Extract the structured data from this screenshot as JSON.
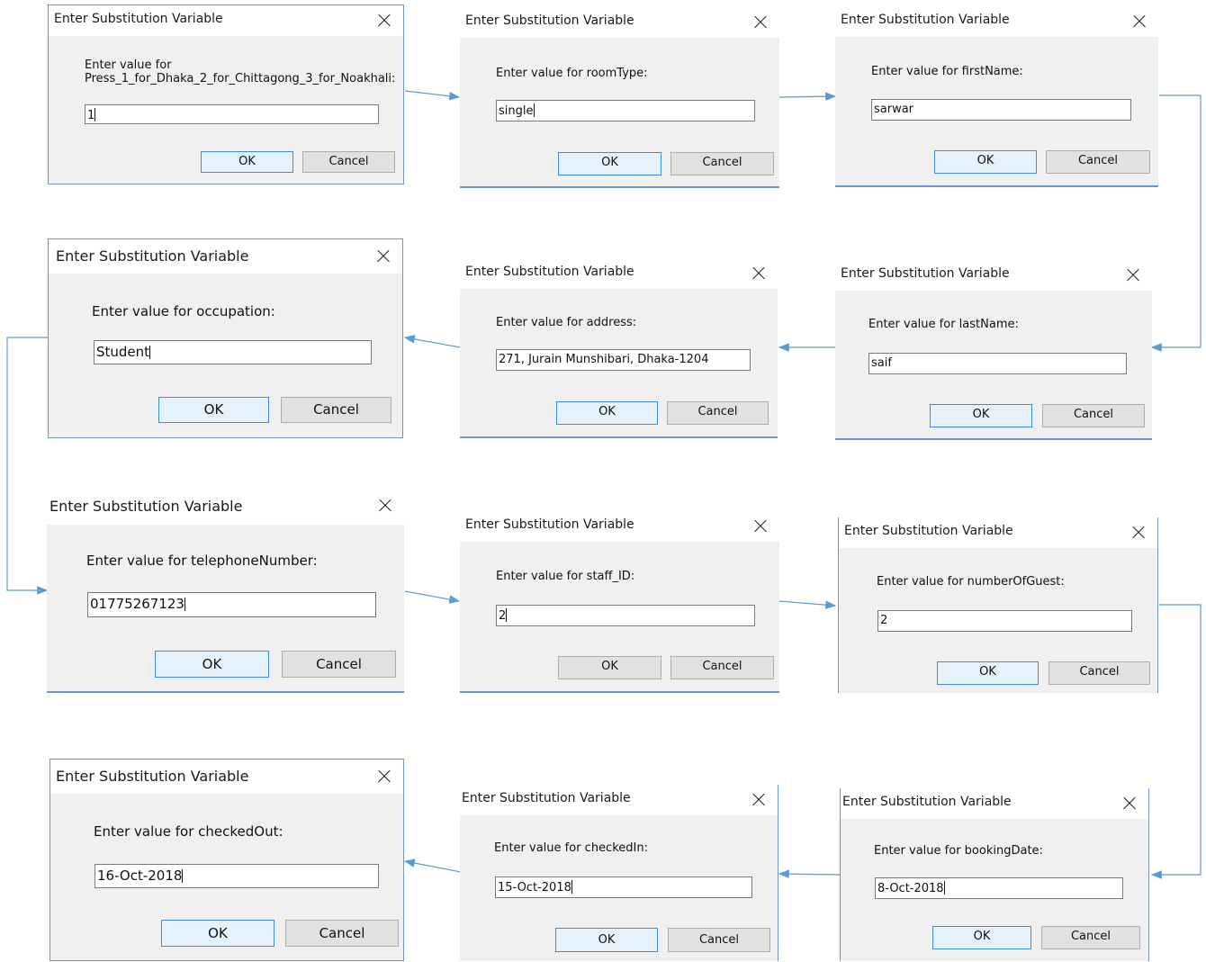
{
  "dialog_title": "Enter Substitution Variable",
  "ok_label": "OK",
  "cancel_label": "Cancel",
  "dialogs": [
    {
      "prompt": "Enter value for\nPress_1_for_Dhaka_2_for_Chittagong_3_for_Noakhali:",
      "value": "1"
    },
    {
      "prompt": "Enter value for roomType:",
      "value": "single"
    },
    {
      "prompt": "Enter value for firstName:",
      "value": "sarwar"
    },
    {
      "prompt": "Enter value for occupation:",
      "value": "Student"
    },
    {
      "prompt": "Enter value for address:",
      "value": "271, Jurain Munshibari, Dhaka-1204"
    },
    {
      "prompt": "Enter value for lastName:",
      "value": "saif"
    },
    {
      "prompt": "Enter value for telephoneNumber:",
      "value": "01775267123"
    },
    {
      "prompt": "Enter value for staff_ID:",
      "value": "2"
    },
    {
      "prompt": "Enter value for numberOfGuest:",
      "value": "2"
    },
    {
      "prompt": "Enter value for checkedOut:",
      "value": "16-Oct-2018"
    },
    {
      "prompt": "Enter value for checkedIn:",
      "value": "15-Oct-2018"
    },
    {
      "prompt": "Enter value for bookingDate:",
      "value": "8-Oct-2018"
    }
  ],
  "colors": {
    "arrow": "#5b9bd5",
    "dialog_bg": "#f0f0f0",
    "ok_border": "#3c8de2"
  }
}
